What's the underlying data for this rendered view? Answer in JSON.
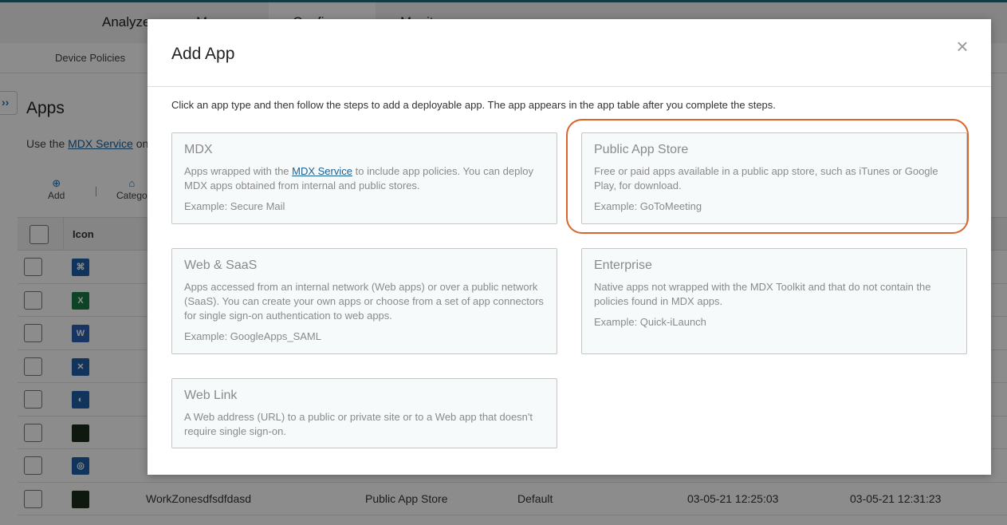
{
  "topnav": {
    "items": [
      "Analyze",
      "Manage",
      "Configure",
      "Monitor"
    ]
  },
  "subnav": {
    "item": "Device Policies"
  },
  "page": {
    "title": "Apps",
    "desc_prefix": "Use the ",
    "desc_link": "MDX Service",
    "desc_suffix": " on",
    "expand_icon": "double-chevron-right-icon",
    "expand_glyph": "››"
  },
  "toolbar": {
    "add_label": "Add",
    "category_label": "Catego"
  },
  "table": {
    "icon_header": "Icon",
    "rows": [
      {
        "icon": "secure-mail-icon",
        "color": "#1f5fa8",
        "glyph": "⌘",
        "name": "",
        "type": "",
        "category": "",
        "created": "",
        "updated": ""
      },
      {
        "icon": "excel-icon",
        "color": "#1d7a45",
        "glyph": "X",
        "name": "",
        "type": "",
        "category": "",
        "created": "",
        "updated": ""
      },
      {
        "icon": "word-icon",
        "color": "#2b5fb4",
        "glyph": "W",
        "name": "",
        "type": "",
        "category": "",
        "created": "",
        "updated": ""
      },
      {
        "icon": "citrix-icon",
        "color": "#1f5fa8",
        "glyph": "✕",
        "name": "",
        "type": "",
        "category": "",
        "created": "",
        "updated": ""
      },
      {
        "icon": "webex-icon",
        "color": "#1f5fa8",
        "glyph": "◐",
        "name": "",
        "type": "",
        "category": "",
        "created": "",
        "updated": ""
      },
      {
        "icon": "workzone-icon",
        "color": "#1c2d1c",
        "glyph": "",
        "name": "",
        "type": "",
        "category": "",
        "created": "",
        "updated": ""
      },
      {
        "icon": "citrix-files-icon",
        "color": "#1f5fa8",
        "glyph": "◎",
        "name": "",
        "type": "",
        "category": "",
        "created": "",
        "updated": ""
      },
      {
        "icon": "workzone-icon",
        "color": "#1c2d1c",
        "glyph": "",
        "name": "WorkZonesdfsdfdasd",
        "type": "Public App Store",
        "category": "Default",
        "created": "03-05-21 12:25:03",
        "updated": "03-05-21 12:31:23"
      }
    ]
  },
  "modal": {
    "title": "Add App",
    "close_glyph": "×",
    "intro": "Click an app type and then follow the steps to add a deployable app. The app appears in the app table after you complete the steps.",
    "cards": {
      "mdx": {
        "title": "MDX",
        "desc_prefix": "Apps wrapped with the ",
        "desc_link": "MDX Service",
        "desc_suffix": " to include app policies. You can deploy MDX apps obtained from internal and public stores.",
        "example": "Example: Secure Mail"
      },
      "public_store": {
        "title": "Public App Store",
        "desc": "Free or paid apps available in a public app store, such as iTunes or Google Play, for download.",
        "example": "Example: GoToMeeting"
      },
      "web_saas": {
        "title": "Web & SaaS",
        "desc": "Apps accessed from an internal network (Web apps) or over a public network (SaaS). You can create your own apps or choose from a set of app connectors for single sign-on authentication to web apps.",
        "example": "Example: GoogleApps_SAML"
      },
      "enterprise": {
        "title": "Enterprise",
        "desc": "Native apps not wrapped with the MDX Toolkit and that do not contain the policies found in MDX apps.",
        "example": "Example: Quick-iLaunch"
      },
      "web_link": {
        "title": "Web Link",
        "desc": "A Web address (URL) to a public or private site or to a Web app that doesn't require single sign-on."
      }
    }
  },
  "colors": {
    "highlight": "#d8652a",
    "link": "#1a5f94",
    "accent": "#1a73b8"
  }
}
